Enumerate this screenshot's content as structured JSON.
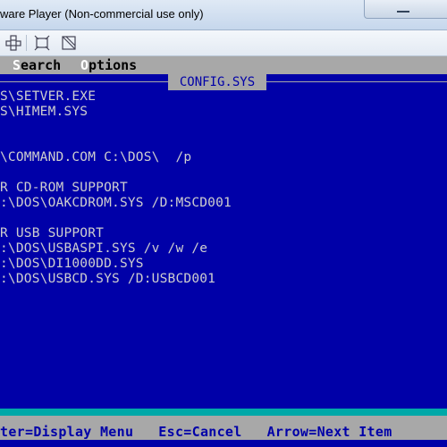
{
  "window": {
    "title": "ware Player (Non-commercial use only)"
  },
  "toolbar": {
    "icons": [
      "move-icon",
      "fullscreen-icon",
      "unity-icon"
    ]
  },
  "dos": {
    "menu": [
      {
        "hot": "S",
        "rest": "earch"
      },
      {
        "hot": "O",
        "rest": "ptions"
      }
    ],
    "file_title": "CONFIG.SYS",
    "lines": [
      "S\\SETVER.EXE",
      "S\\HIMEM.SYS",
      "",
      "",
      "\\COMMAND.COM C:\\DOS\\  /p",
      "",
      "R CD-ROM SUPPORT",
      ":\\DOS\\OAKCDROM.SYS /D:MSCD001",
      "",
      "R USB SUPPORT",
      ":\\DOS\\USBASPI.SYS /v /w /e",
      ":\\DOS\\DI1000DD.SYS",
      ":\\DOS\\USBCD.SYS /D:USBCD001"
    ],
    "status": "ter=Display Menu   Esc=Cancel   Arrow=Next Item"
  },
  "colors": {
    "dos_background": "#0000a8",
    "dos_text": "#cfcfcf",
    "menu_background": "#a8a8a8",
    "status_accent": "#00a8a8"
  }
}
